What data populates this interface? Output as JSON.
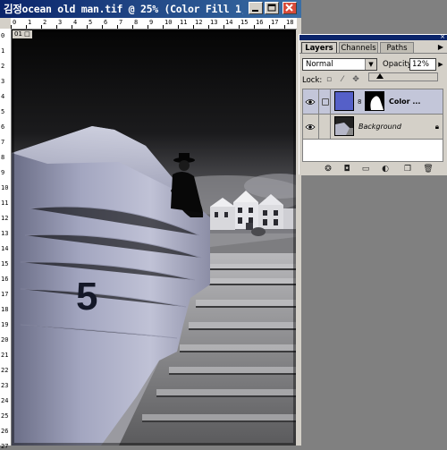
{
  "document": {
    "title": "김정ocean old man.tif @ 25% (Color Fill 1, ...",
    "canvas_chip": "01 □",
    "ruler_top_labels": [
      "0",
      "1",
      "2",
      "3",
      "4",
      "5",
      "6",
      "7",
      "8",
      "9",
      "10",
      "11",
      "12",
      "13",
      "14",
      "15",
      "16",
      "17",
      "18"
    ],
    "ruler_left_labels": [
      "0",
      "1",
      "2",
      "3",
      "4",
      "5",
      "6",
      "7",
      "8",
      "9",
      "10",
      "11",
      "12",
      "13",
      "14",
      "15",
      "16",
      "17",
      "18",
      "19",
      "20",
      "21",
      "22",
      "23",
      "24",
      "25",
      "26",
      "27"
    ],
    "photo": {
      "wall_number": "5"
    }
  },
  "window_controls": {
    "minimize_icon": "minimize-icon",
    "maximize_icon": "maximize-icon",
    "close_icon": "close-icon"
  },
  "layers_palette": {
    "tabs": [
      "Layers",
      "Channels",
      "Paths"
    ],
    "active_tab": "Layers",
    "blend_mode": "Normal",
    "opacity_label": "Opacity:",
    "opacity_value": "12%",
    "opacity_level": 0.12,
    "lock_label": "Lock:",
    "layers": [
      {
        "name": "Color ...",
        "visible": true,
        "selected": true,
        "thumb_color": "#5560c8"
      },
      {
        "name": "Background",
        "visible": true,
        "selected": false,
        "locked": true
      }
    ]
  },
  "colors": {
    "title_bar": "#0a246a",
    "chrome": "#d4d0c8",
    "workspace": "#808080",
    "fill_layer": "#5560c8"
  }
}
